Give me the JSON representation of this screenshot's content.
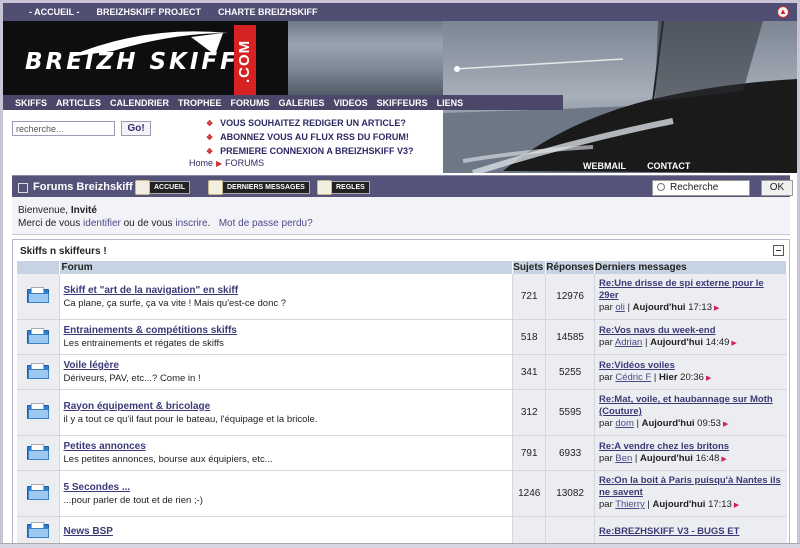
{
  "topnav": {
    "links": [
      "- ACCUEIL -",
      "BREIZHSKIFF PROJECT",
      "CHARTE BREIZHSKIFF"
    ]
  },
  "logo": {
    "text": "BREIZH SKIFF",
    "com": ".COM"
  },
  "menubar": {
    "items": [
      "SKIFFS",
      "ARTICLES",
      "CALENDRIER",
      "TROPHEE",
      "FORUMS",
      "GALERIES",
      "VIDEOS",
      "SKIFFEURS",
      "LIENS"
    ]
  },
  "search_top": {
    "placeholder": "recherche...",
    "value": "recherche...",
    "button": "Go!"
  },
  "promos": [
    "VOUS SOUHAITEZ REDIGER UN ARTICLE?",
    "ABONNEZ VOUS AU FLUX RSS DU FORUM!",
    "PREMIERE CONNEXION A BREIZHSKIFF V3?"
  ],
  "breadcrumb": {
    "home": "Home",
    "current": "FORUMS"
  },
  "hull_links": [
    "WEBMAIL",
    "CONTACT"
  ],
  "forum_bar": {
    "title": "Forums Breizhskiff",
    "buttons": [
      "ACCUEIL",
      "DERNIERS MESSAGES",
      "REGLES"
    ],
    "search_value": "Recherche",
    "ok": "OK"
  },
  "welcome": {
    "greeting": "Bienvenue,",
    "user": "Invité",
    "line2_a": "Merci de vous",
    "login": "identifier",
    "line2_b": "ou de vous",
    "register": "inscrire",
    "forgot": "Mot de passe perdu?"
  },
  "section": {
    "title": "Skiffs n skiffeurs !",
    "headers": {
      "forum": "Forum",
      "topics": "Sujets",
      "replies": "Réponses",
      "last": "Derniers messages"
    },
    "rows": [
      {
        "name": "Skiff et \"art de la navigation\" en skiff",
        "desc": "Ca plane, ça surfe, ça va vite ! Mais qu'est-ce donc ?",
        "topics": "721",
        "replies": "12976",
        "last_title": "Re:Une drisse de spi externe pour le 29er",
        "by": "par",
        "user": "oli",
        "when": "Aujourd'hui",
        "time": "17:13"
      },
      {
        "name": "Entrainements & compétitions skiffs",
        "desc": "Les entrainements et régates de skiffs",
        "topics": "518",
        "replies": "14585",
        "last_title": "Re:Vos navs du week-end",
        "by": "par",
        "user": "Adrian",
        "when": "Aujourd'hui",
        "time": "14:49"
      },
      {
        "name": "Voile légère",
        "desc": "Dériveurs, PAV, etc...? Come in !",
        "topics": "341",
        "replies": "5255",
        "last_title": "Re:Vidéos voiles",
        "by": "par",
        "user": "Cédric F",
        "when": "Hier",
        "time": "20:36"
      },
      {
        "name": "Rayon équipement & bricolage",
        "desc": "il y a tout ce qu'il faut pour le bateau, l'équipage et la bricole.",
        "topics": "312",
        "replies": "5595",
        "last_title": "Re:Mat, voile, et haubannage sur Moth (Couture)",
        "by": "par",
        "user": "dom",
        "when": "Aujourd'hui",
        "time": "09:53"
      },
      {
        "name": "Petites annonces",
        "desc": "Les petites annonces, bourse aux équipiers, etc...",
        "topics": "791",
        "replies": "6933",
        "last_title": "Re:A vendre chez les britons",
        "by": "par",
        "user": "Ben",
        "when": "Aujourd'hui",
        "time": "16:48"
      },
      {
        "name": "5 Secondes ...",
        "desc": "...pour parler de tout et de rien ;-)",
        "topics": "1246",
        "replies": "13082",
        "last_title": "Re:On la boit à Paris puisqu'à Nantes ils ne savent",
        "by": "par",
        "user": "Thierry",
        "when": "Aujourd'hui",
        "time": "17:13"
      },
      {
        "name": "News BSP",
        "desc": "",
        "topics": "",
        "replies": "",
        "last_title": "Re:BREZHSKIFF V3 - BUGS ET",
        "by": "",
        "user": "",
        "when": "",
        "time": ""
      }
    ]
  },
  "colors": {
    "nav": "#514e73",
    "bar": "#56537a",
    "header_row": "#c6d3e2",
    "link": "#3b3a78",
    "accent_red": "#d62222"
  }
}
